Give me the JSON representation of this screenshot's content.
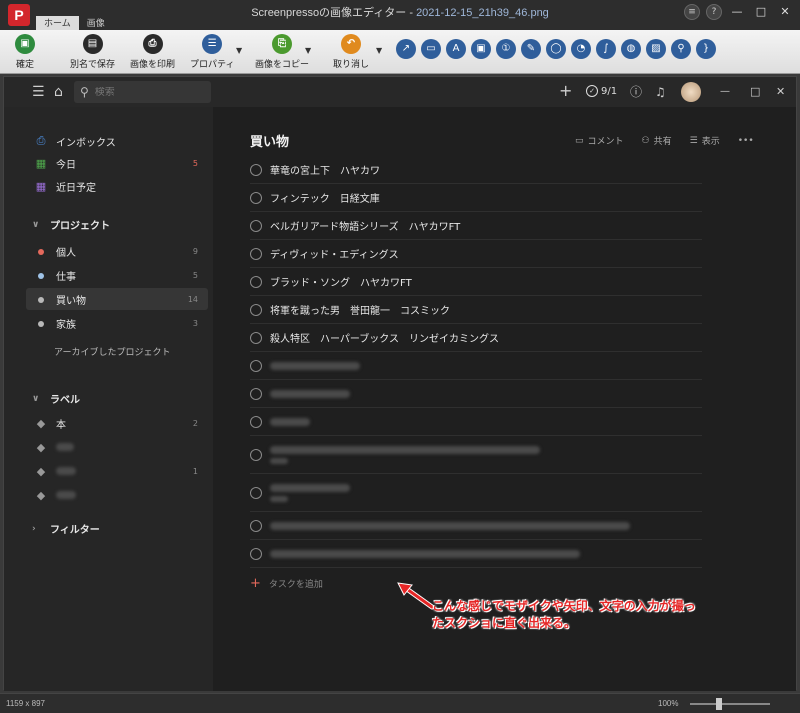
{
  "app": {
    "logo": "P",
    "title_prefix": "Screenpressoの画像エディター - ",
    "file_name": "2021-12-15_21h39_46.png",
    "tabs": [
      "ホーム",
      "画像"
    ],
    "window_buttons": [
      "≡",
      "?"
    ],
    "window_controls": [
      "—",
      "□",
      "✕"
    ]
  },
  "ribbon": {
    "buttons": [
      {
        "label": "確定",
        "icon": "save-icon",
        "color": "#2e8b3e"
      },
      {
        "label": "別名で保存",
        "icon": "save-as-icon",
        "color": "#2a2a2a"
      },
      {
        "label": "画像を印刷",
        "icon": "print-icon",
        "color": "#2a2a2a"
      },
      {
        "label": "プロパティ",
        "icon": "properties-icon",
        "color": "#2f5e9b"
      },
      {
        "label": "画像をコピー",
        "icon": "copy-icon",
        "color": "#4b9a2e"
      },
      {
        "label": "取り消し",
        "icon": "undo-icon",
        "color": "#e08a1e"
      }
    ],
    "tools": [
      "arrow-tool",
      "rectangle-tool",
      "text-tool",
      "label-tool",
      "numbered-step-tool",
      "highlighter-tool",
      "ellipse-tool",
      "callout-tool",
      "freehand-tool",
      "blur-drop-tool",
      "image-tool",
      "magnifier-tool",
      "brace-tool"
    ]
  },
  "todoist": {
    "search_placeholder": "検索",
    "karma": "9/1",
    "sidebar": {
      "inbox": "インボックス",
      "today": "今日",
      "today_count": "5",
      "upcoming": "近日予定",
      "projects_heading": "プロジェクト",
      "projects": [
        {
          "name": "個人",
          "count": "9",
          "color": "#e4695c"
        },
        {
          "name": "仕事",
          "count": "5",
          "color": "#9fc3e7"
        },
        {
          "name": "買い物",
          "count": "14",
          "color": "#b8b8b8"
        },
        {
          "name": "家族",
          "count": "3",
          "color": "#b8b8b8"
        }
      ],
      "archived": "アーカイブしたプロジェクト",
      "labels_heading": "ラベル",
      "label_first": "本",
      "label_first_count": "2",
      "label_third_count": "1",
      "filters_heading": "フィルター"
    },
    "main": {
      "title": "買い物",
      "comment": "コメント",
      "share": "共有",
      "view": "表示",
      "tasks": [
        "華竜の宮上下　ハヤカワ",
        "フィンテック　日経文庫",
        "ベルガリアード物語シリーズ　ハヤカワFT",
        "ディヴィッド・エディングス",
        "ブラッド・ソング　ハヤカワFT",
        "将軍を蹴った男　誉田龍一　コスミック",
        "殺人特区　ハーパーブックス　リンゼイカミングス"
      ],
      "add_task": "タスクを追加"
    }
  },
  "annotation": {
    "line1": "こんな感じでモザイクや矢印、文字の入力が撮っ",
    "line2": "たスクショに直ぐ出来る。",
    "color": "#e52626"
  },
  "status": {
    "dimensions": "1159 x 897",
    "zoom": "100%"
  }
}
